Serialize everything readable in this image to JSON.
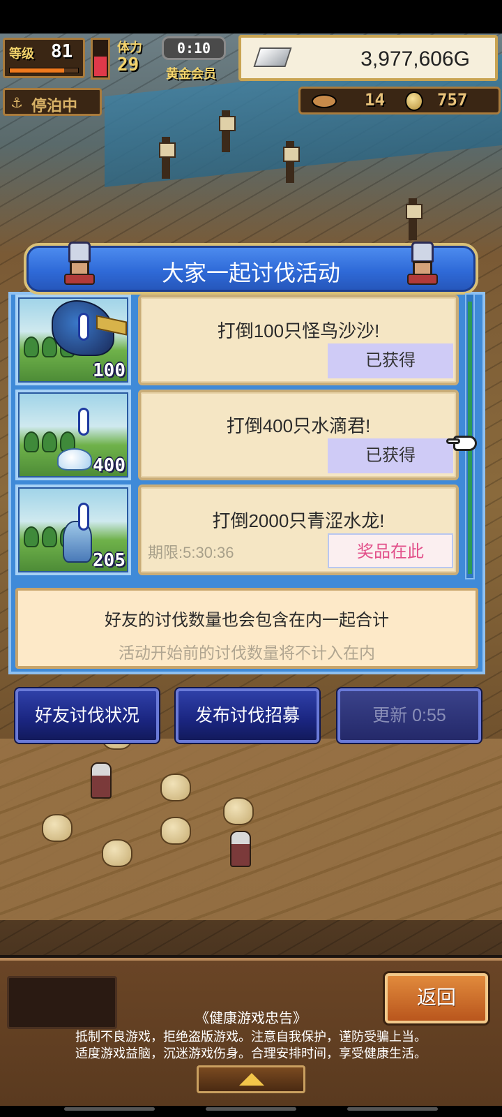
{
  "hud": {
    "level_label": "等级",
    "level_value": "81",
    "xp_fraction": 0.8,
    "stamina_fraction": 0.6,
    "stamina_label": "体力",
    "stamina_value": "29",
    "timer": "0:10",
    "membership": "黄金会员",
    "money": "3,977,606G",
    "docked_status": "停泊中",
    "fish_count": "14",
    "coin_count": "757"
  },
  "dialog": {
    "title": "大家一起讨伐活动",
    "quests": [
      {
        "title": "打倒100只怪鸟沙沙!",
        "count": "100",
        "button": "已获得",
        "deadline": ""
      },
      {
        "title": "打倒400只水滴君!",
        "count": "400",
        "button": "已获得",
        "deadline": ""
      },
      {
        "title": "打倒2000只青涩水龙!",
        "count": "205",
        "button": "奖品在此",
        "deadline": "期限:5:30:36"
      }
    ],
    "note_line1": "好友的讨伐数量也会包含在内一起合计",
    "note_line2": "活动开始前的讨伐数量将不计入在内"
  },
  "actions": {
    "friends_status": "好友讨伐状况",
    "post_recruit": "发布讨伐招募",
    "refresh": "更新 0:55"
  },
  "bottom": {
    "back": "返回",
    "notice_title": "《健康游戏忠告》",
    "notice_line1": "抵制不良游戏，拒绝盗版游戏。注意自我保护，谨防受骗上当。",
    "notice_line2": "适度游戏益脑，沉迷游戏伤身。合理安排时间，享受健康生活。"
  },
  "colors": {
    "header_blue": "#2f6ad8",
    "claimed_button": "#cfcbf6",
    "prize_text": "#e2508a",
    "back_button": "#d9782e"
  },
  "icons": [
    "anchor-icon",
    "silver-bar-icon",
    "fish-icon",
    "coin-icon",
    "pointer-hand-icon",
    "expand-up-icon"
  ]
}
